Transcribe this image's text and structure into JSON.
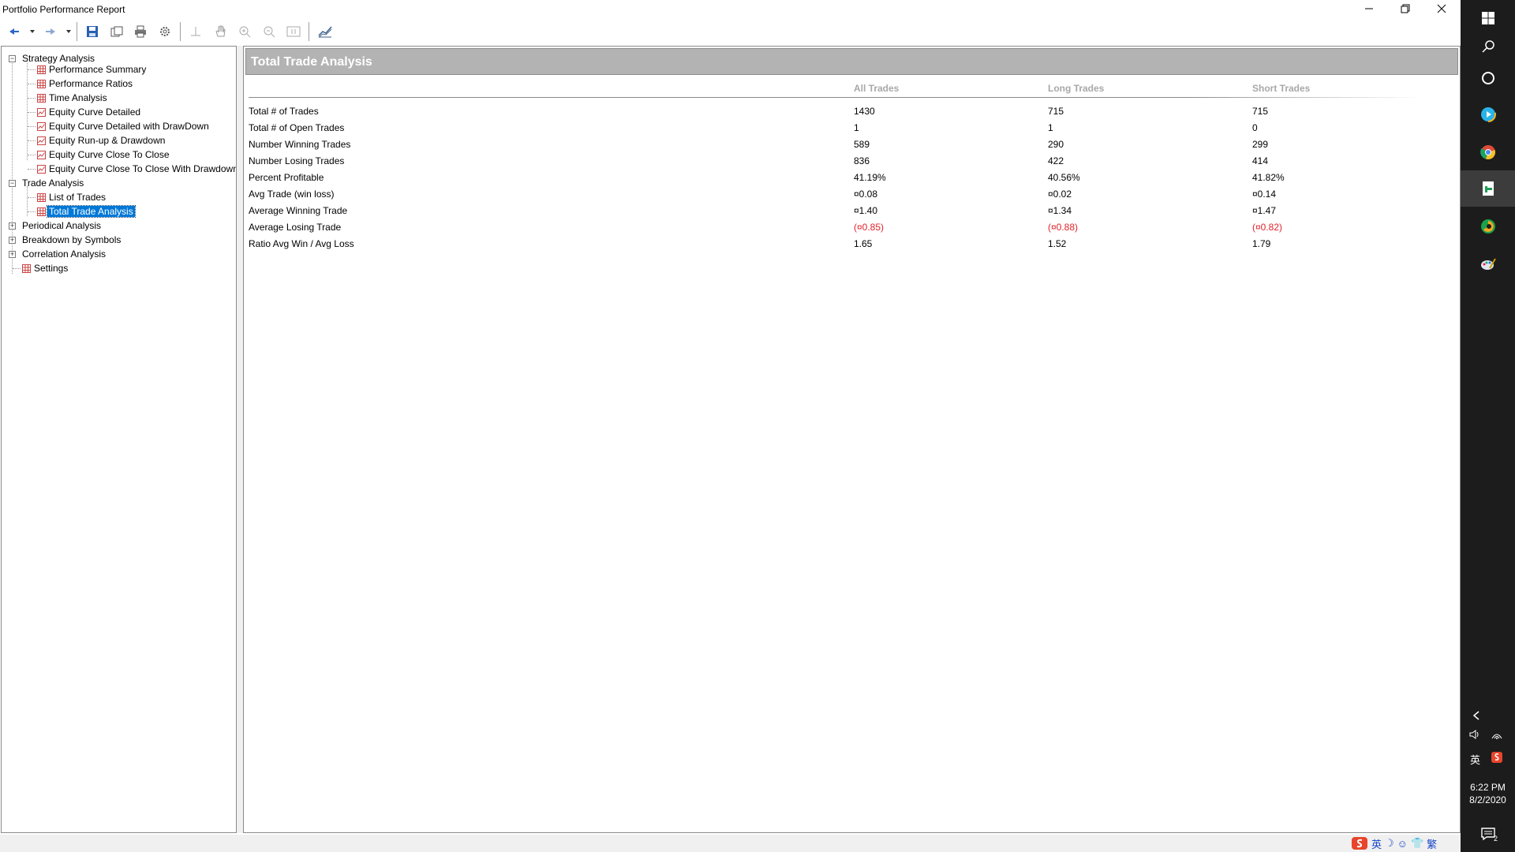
{
  "window": {
    "title": "Portfolio Performance Report"
  },
  "tree": {
    "groups": [
      {
        "label": "Strategy Analysis",
        "expanded": true,
        "items": [
          {
            "label": "Performance Summary",
            "icon": "grid-icon"
          },
          {
            "label": "Performance Ratios",
            "icon": "grid-icon"
          },
          {
            "label": "Time Analysis",
            "icon": "grid-icon"
          },
          {
            "label": "Equity Curve Detailed",
            "icon": "chart-icon"
          },
          {
            "label": "Equity Curve Detailed with DrawDown",
            "icon": "chart-icon"
          },
          {
            "label": "Equity Run-up & Drawdown",
            "icon": "chart-icon"
          },
          {
            "label": "Equity Curve Close To Close",
            "icon": "chart-icon"
          },
          {
            "label": "Equity Curve Close To Close With Drawdown",
            "icon": "chart-icon"
          }
        ]
      },
      {
        "label": "Trade Analysis",
        "expanded": true,
        "items": [
          {
            "label": "List of Trades",
            "icon": "grid-icon"
          },
          {
            "label": "Total Trade Analysis",
            "icon": "grid-icon",
            "selected": true
          }
        ]
      },
      {
        "label": "Periodical Analysis",
        "expanded": false
      },
      {
        "label": "Breakdown by Symbols",
        "expanded": false
      },
      {
        "label": "Correlation Analysis",
        "expanded": false
      }
    ],
    "settings_label": "Settings"
  },
  "report": {
    "title": "Total Trade Analysis",
    "columns": [
      "All Trades",
      "Long Trades",
      "Short Trades"
    ],
    "rows": [
      {
        "label": "Total # of Trades",
        "values": [
          "1430",
          "715",
          "715"
        ],
        "negative": false
      },
      {
        "label": "Total # of Open Trades",
        "values": [
          "1",
          "1",
          "0"
        ],
        "negative": false
      },
      {
        "label": "Number Winning Trades",
        "values": [
          "589",
          "290",
          "299"
        ],
        "negative": false
      },
      {
        "label": "Number Losing Trades",
        "values": [
          "836",
          "422",
          "414"
        ],
        "negative": false
      },
      {
        "label": "Percent Profitable",
        "values": [
          "41.19%",
          "40.56%",
          "41.82%"
        ],
        "negative": false
      },
      {
        "label": "Avg Trade (win  loss)",
        "values": [
          "¤0.08",
          "¤0.02",
          "¤0.14"
        ],
        "negative": false
      },
      {
        "label": "Average Winning Trade",
        "values": [
          "¤1.40",
          "¤1.34",
          "¤1.47"
        ],
        "negative": false
      },
      {
        "label": "Average Losing Trade",
        "values": [
          "(¤0.85)",
          "(¤0.88)",
          "(¤0.82)"
        ],
        "negative": true
      },
      {
        "label": "Ratio Avg Win / Avg Loss",
        "values": [
          "1.65",
          "1.52",
          "1.79"
        ],
        "negative": false
      }
    ]
  },
  "ime": {
    "items": [
      "英",
      "☽",
      "☺",
      "👕",
      "繁"
    ]
  },
  "taskbar": {
    "tray_lang": "英",
    "time": "6:22 PM",
    "date": "8/2/2020",
    "notifications": "2"
  },
  "colors": {
    "accent": "#0078d7",
    "negative": "#e0232a",
    "header_band": "#b3b3b3",
    "taskbar": "#1c1c1c"
  }
}
